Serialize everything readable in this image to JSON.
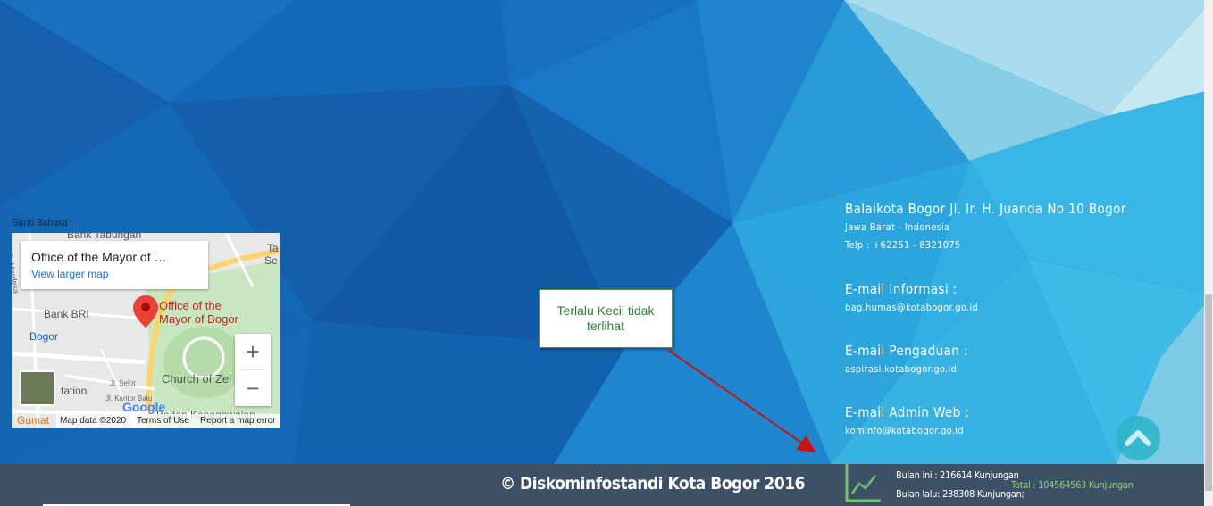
{
  "language_label": "Ganti Bahasa :",
  "map": {
    "place_title": "Office of the Mayor of …",
    "view_larger": "View larger map",
    "pin_label_1": "Office of the",
    "pin_label_2": "Mayor of Bogor",
    "labels": {
      "bank_tabungan": "Bank Tabungan",
      "bank_bri": "Bank BRI",
      "bogor": "Bogor",
      "merdeka": "Jl. Merdeka",
      "church": "Church of Zel",
      "tation": "tation",
      "selot": "Jl. Selot",
      "kantor_batu": "Jl. Kantor Batu",
      "badan": "Badan Kepegawaian",
      "ta": "Ta",
      "se": "Se"
    },
    "zoom_in": "+",
    "zoom_out": "−",
    "gumat": "Gumat",
    "google": "Google",
    "map_data": "Map data ©2020",
    "terms": "Terms of Use",
    "report": "Report a map error"
  },
  "contact": {
    "address": "Balaikota Bogor Jl. Ir. H. Juanda No 10 Bogor",
    "region": "Jawa Barat - Indonesia",
    "phone": "Telp : +62251 - 8321075",
    "email_info_label": "E-mail Informasi :",
    "email_info": "bag.humas@kotabogor.go.id",
    "email_complaint_label": "E-mail Pengaduan :",
    "email_complaint": "aspirasi.kotabogor.go.id",
    "email_admin_label": "E-mail Admin Web :",
    "email_admin": "kominfo@kotabogor.go.id"
  },
  "callout": {
    "line1": "Terlalu Kecil tidak",
    "line2": "terlihat"
  },
  "footer": {
    "copyright": "© Diskominfostandi Kota Bogor 2016",
    "this_month": "Bulan ini : 216614 Kunjungan",
    "last_month": "Bulan lalu: 238308 Kunjungan;",
    "total": "Total : 104564563 Kunjungan"
  },
  "colors": {
    "footer_bg": "#3d5066",
    "callout_text": "#2e7d32",
    "arrow": "#cc1111",
    "total_text": "#8fce7a",
    "to_top": "#2bb5c9"
  },
  "icons": {
    "stats": "line-chart-icon",
    "to_top": "chevron-up-icon",
    "map_pin": "map-pin-icon"
  }
}
